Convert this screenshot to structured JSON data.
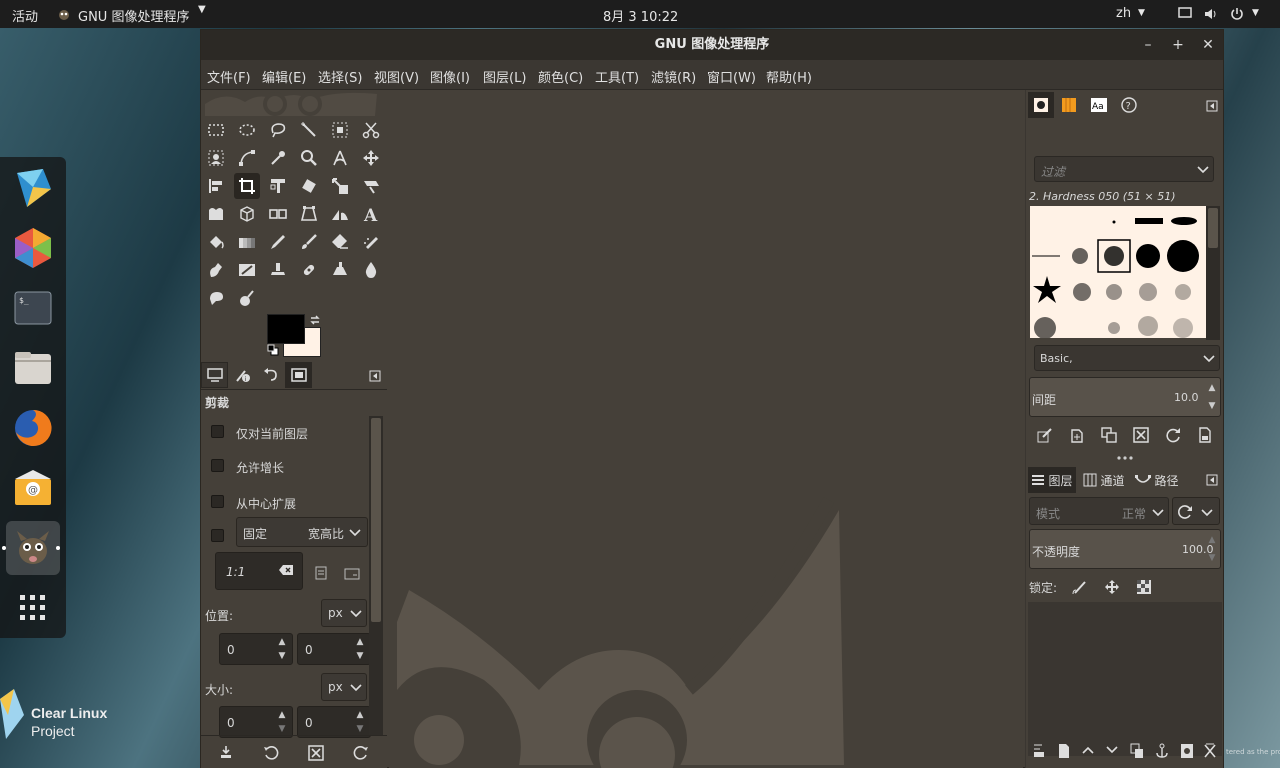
{
  "topbar": {
    "activities": "活动",
    "app_name": "GNU 图像处理程序",
    "clock": "8月 3  10:22",
    "input_method": "zh"
  },
  "window": {
    "title": "GNU 图像处理程序"
  },
  "menubar": {
    "items": [
      "文件(F)",
      "编辑(E)",
      "选择(S)",
      "视图(V)",
      "图像(I)",
      "图层(L)",
      "颜色(C)",
      "工具(T)",
      "滤镜(R)",
      "窗口(W)",
      "帮助(H)"
    ]
  },
  "tool_options": {
    "title": "剪裁",
    "current_layer_only": "仅对当前图层",
    "allow_growing": "允许增长",
    "expand_from_center": "从中心扩展",
    "fixed_label": "固定",
    "fixed_mode": "宽高比",
    "ratio_value": "1:1",
    "position_label": "位置:",
    "position_unit": "px",
    "position_x": "0",
    "position_y": "0",
    "size_label": "大小:",
    "size_unit": "px",
    "size_w": "0",
    "size_h": "0"
  },
  "brushes": {
    "filter_placeholder": "过滤",
    "current_brush": "2. Hardness 050 (51 × 51)",
    "tag": "Basic,",
    "spacing_label": "间距",
    "spacing_value": "10.0"
  },
  "layers": {
    "tab_layers": "图层",
    "tab_channels": "通道",
    "tab_paths": "路径",
    "mode_label": "模式",
    "mode_value": "正常",
    "opacity_label": "不透明度",
    "opacity_value": "100.0",
    "lock_label": "锁定:"
  },
  "desktop": {
    "brand_line1": "Clear Linux",
    "brand_line2": "Project",
    "watermark": "tered as the propert"
  },
  "colors": {
    "accent": "#e95420",
    "panel": "#454039",
    "fg_color": "#000000",
    "bg_color": "#fff2e6"
  }
}
